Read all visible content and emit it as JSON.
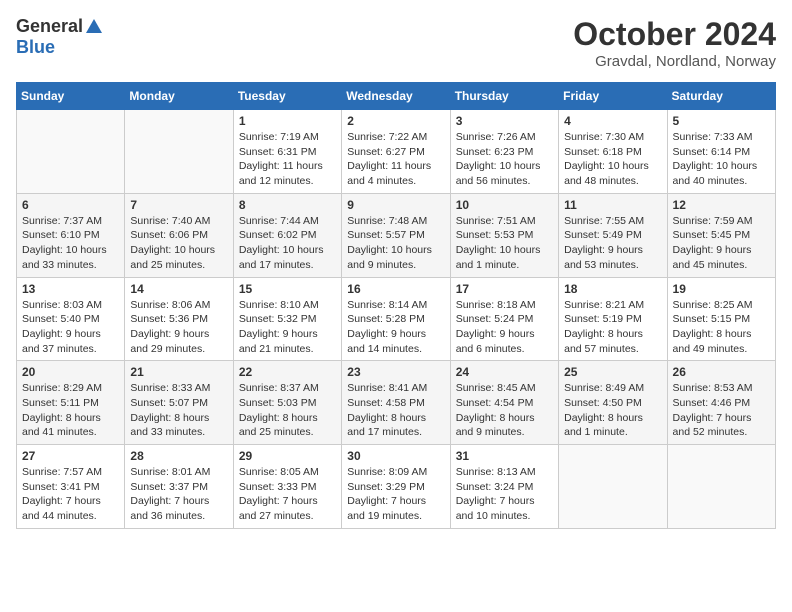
{
  "header": {
    "logo_general": "General",
    "logo_blue": "Blue",
    "month_title": "October 2024",
    "location": "Gravdal, Nordland, Norway"
  },
  "days_of_week": [
    "Sunday",
    "Monday",
    "Tuesday",
    "Wednesday",
    "Thursday",
    "Friday",
    "Saturday"
  ],
  "weeks": [
    [
      {
        "day": "",
        "info": ""
      },
      {
        "day": "",
        "info": ""
      },
      {
        "day": "1",
        "info": "Sunrise: 7:19 AM\nSunset: 6:31 PM\nDaylight: 11 hours\nand 12 minutes."
      },
      {
        "day": "2",
        "info": "Sunrise: 7:22 AM\nSunset: 6:27 PM\nDaylight: 11 hours\nand 4 minutes."
      },
      {
        "day": "3",
        "info": "Sunrise: 7:26 AM\nSunset: 6:23 PM\nDaylight: 10 hours\nand 56 minutes."
      },
      {
        "day": "4",
        "info": "Sunrise: 7:30 AM\nSunset: 6:18 PM\nDaylight: 10 hours\nand 48 minutes."
      },
      {
        "day": "5",
        "info": "Sunrise: 7:33 AM\nSunset: 6:14 PM\nDaylight: 10 hours\nand 40 minutes."
      }
    ],
    [
      {
        "day": "6",
        "info": "Sunrise: 7:37 AM\nSunset: 6:10 PM\nDaylight: 10 hours\nand 33 minutes."
      },
      {
        "day": "7",
        "info": "Sunrise: 7:40 AM\nSunset: 6:06 PM\nDaylight: 10 hours\nand 25 minutes."
      },
      {
        "day": "8",
        "info": "Sunrise: 7:44 AM\nSunset: 6:02 PM\nDaylight: 10 hours\nand 17 minutes."
      },
      {
        "day": "9",
        "info": "Sunrise: 7:48 AM\nSunset: 5:57 PM\nDaylight: 10 hours\nand 9 minutes."
      },
      {
        "day": "10",
        "info": "Sunrise: 7:51 AM\nSunset: 5:53 PM\nDaylight: 10 hours\nand 1 minute."
      },
      {
        "day": "11",
        "info": "Sunrise: 7:55 AM\nSunset: 5:49 PM\nDaylight: 9 hours\nand 53 minutes."
      },
      {
        "day": "12",
        "info": "Sunrise: 7:59 AM\nSunset: 5:45 PM\nDaylight: 9 hours\nand 45 minutes."
      }
    ],
    [
      {
        "day": "13",
        "info": "Sunrise: 8:03 AM\nSunset: 5:40 PM\nDaylight: 9 hours\nand 37 minutes."
      },
      {
        "day": "14",
        "info": "Sunrise: 8:06 AM\nSunset: 5:36 PM\nDaylight: 9 hours\nand 29 minutes."
      },
      {
        "day": "15",
        "info": "Sunrise: 8:10 AM\nSunset: 5:32 PM\nDaylight: 9 hours\nand 21 minutes."
      },
      {
        "day": "16",
        "info": "Sunrise: 8:14 AM\nSunset: 5:28 PM\nDaylight: 9 hours\nand 14 minutes."
      },
      {
        "day": "17",
        "info": "Sunrise: 8:18 AM\nSunset: 5:24 PM\nDaylight: 9 hours\nand 6 minutes."
      },
      {
        "day": "18",
        "info": "Sunrise: 8:21 AM\nSunset: 5:19 PM\nDaylight: 8 hours\nand 57 minutes."
      },
      {
        "day": "19",
        "info": "Sunrise: 8:25 AM\nSunset: 5:15 PM\nDaylight: 8 hours\nand 49 minutes."
      }
    ],
    [
      {
        "day": "20",
        "info": "Sunrise: 8:29 AM\nSunset: 5:11 PM\nDaylight: 8 hours\nand 41 minutes."
      },
      {
        "day": "21",
        "info": "Sunrise: 8:33 AM\nSunset: 5:07 PM\nDaylight: 8 hours\nand 33 minutes."
      },
      {
        "day": "22",
        "info": "Sunrise: 8:37 AM\nSunset: 5:03 PM\nDaylight: 8 hours\nand 25 minutes."
      },
      {
        "day": "23",
        "info": "Sunrise: 8:41 AM\nSunset: 4:58 PM\nDaylight: 8 hours\nand 17 minutes."
      },
      {
        "day": "24",
        "info": "Sunrise: 8:45 AM\nSunset: 4:54 PM\nDaylight: 8 hours\nand 9 minutes."
      },
      {
        "day": "25",
        "info": "Sunrise: 8:49 AM\nSunset: 4:50 PM\nDaylight: 8 hours\nand 1 minute."
      },
      {
        "day": "26",
        "info": "Sunrise: 8:53 AM\nSunset: 4:46 PM\nDaylight: 7 hours\nand 52 minutes."
      }
    ],
    [
      {
        "day": "27",
        "info": "Sunrise: 7:57 AM\nSunset: 3:41 PM\nDaylight: 7 hours\nand 44 minutes."
      },
      {
        "day": "28",
        "info": "Sunrise: 8:01 AM\nSunset: 3:37 PM\nDaylight: 7 hours\nand 36 minutes."
      },
      {
        "day": "29",
        "info": "Sunrise: 8:05 AM\nSunset: 3:33 PM\nDaylight: 7 hours\nand 27 minutes."
      },
      {
        "day": "30",
        "info": "Sunrise: 8:09 AM\nSunset: 3:29 PM\nDaylight: 7 hours\nand 19 minutes."
      },
      {
        "day": "31",
        "info": "Sunrise: 8:13 AM\nSunset: 3:24 PM\nDaylight: 7 hours\nand 10 minutes."
      },
      {
        "day": "",
        "info": ""
      },
      {
        "day": "",
        "info": ""
      }
    ]
  ]
}
